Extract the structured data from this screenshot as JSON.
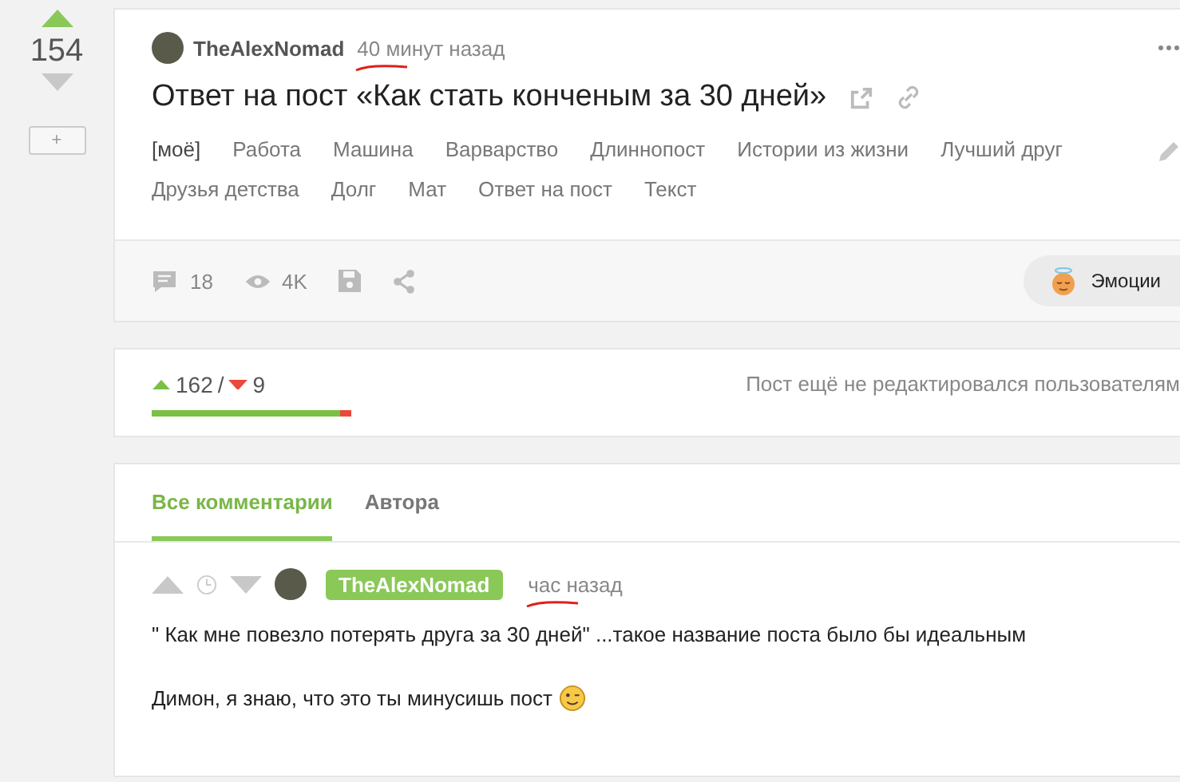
{
  "sidebar": {
    "rating": "154",
    "add_button": "+"
  },
  "post": {
    "author": "TheAlexNomad",
    "time": "40 минут назад",
    "title": "Ответ на пост «Как стать конченым за 30 дней»",
    "tags": [
      {
        "label": "[моё]",
        "kind": "mine"
      },
      {
        "label": "Работа",
        "kind": "tag"
      },
      {
        "label": "Машина",
        "kind": "tag"
      },
      {
        "label": "Варварство",
        "kind": "tag"
      },
      {
        "label": "Длиннопост",
        "kind": "tag"
      },
      {
        "label": "Истории из жизни",
        "kind": "tag"
      },
      {
        "label": "Лучший друг",
        "kind": "tag"
      },
      {
        "label": "Друзья детства",
        "kind": "tag"
      },
      {
        "label": "Долг",
        "kind": "tag"
      },
      {
        "label": "Мат",
        "kind": "tag"
      },
      {
        "label": "Ответ на пост",
        "kind": "tag"
      },
      {
        "label": "Текст",
        "kind": "tag"
      }
    ],
    "comments_count": "18",
    "views": "4K",
    "emotions_button": "Эмоции"
  },
  "rating": {
    "pluses": "162",
    "separator": "/",
    "minuses": "9",
    "level": 0.947,
    "edit_note": "Пост ещё не редактировался пользователям"
  },
  "comments": {
    "tabs": [
      {
        "label": "Все комментарии",
        "selected": true
      },
      {
        "label": "Автора",
        "selected": false
      }
    ],
    "comment": {
      "author": "TheAlexNomad",
      "time": "час назад",
      "paragraphs": [
        "\" Как мне повезло потерять друга за 30 дней\" ...такое название поста было бы идеальным",
        "Димон, я знаю, что это ты минусишь пост"
      ]
    }
  }
}
